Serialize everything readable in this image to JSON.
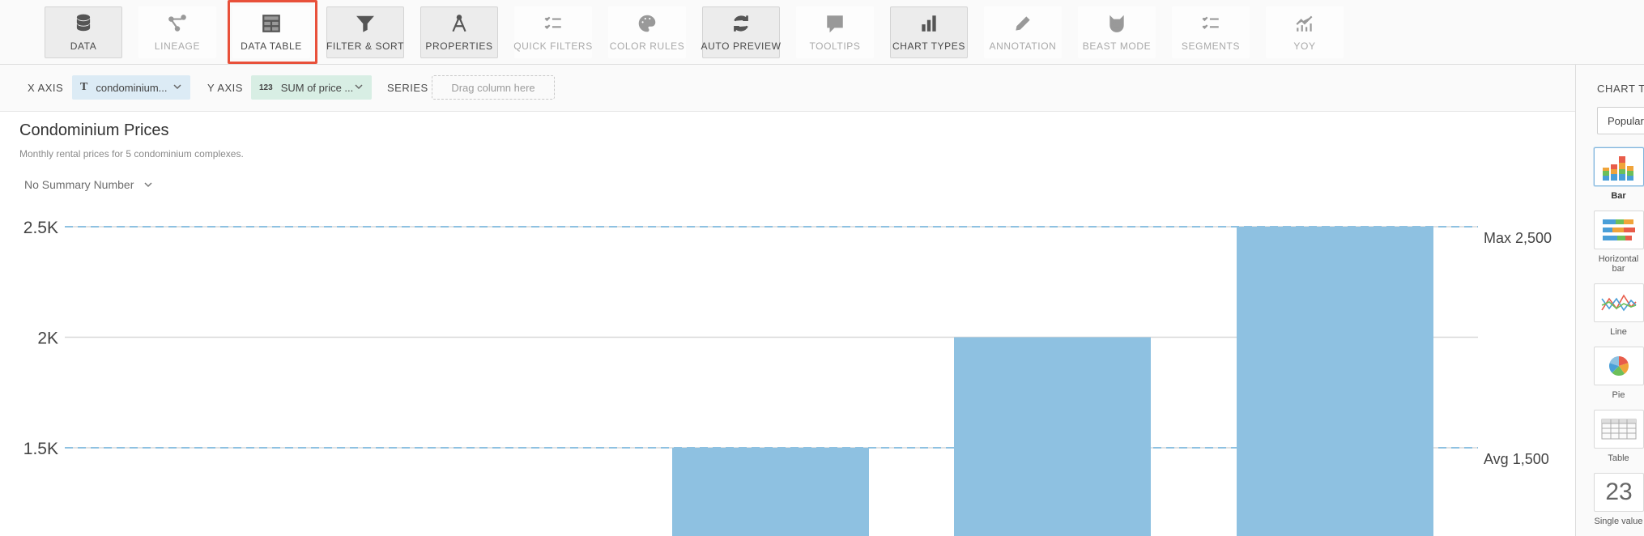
{
  "toolbar": {
    "items": [
      {
        "label": "DATA",
        "icon": "database-icon",
        "active": true
      },
      {
        "label": "LINEAGE",
        "icon": "lineage-icon",
        "active": false
      },
      {
        "label": "DATA TABLE",
        "icon": "table-icon",
        "active": false
      },
      {
        "label": "FILTER & SORT",
        "icon": "filter-icon",
        "active": true
      },
      {
        "label": "PROPERTIES",
        "icon": "compass-icon",
        "active": true
      },
      {
        "label": "QUICK FILTERS",
        "icon": "checklist-icon",
        "active": false
      },
      {
        "label": "COLOR RULES",
        "icon": "palette-icon",
        "active": false
      },
      {
        "label": "AUTO PREVIEW",
        "icon": "refresh-icon",
        "active": true
      },
      {
        "label": "TOOLTIPS",
        "icon": "speech-bubble-icon",
        "active": false
      },
      {
        "label": "CHART TYPES",
        "icon": "bar-chart-icon",
        "active": true
      },
      {
        "label": "ANNOTATION",
        "icon": "pencil-icon",
        "active": false
      },
      {
        "label": "BEAST MODE",
        "icon": "beast-mode-icon",
        "active": false
      },
      {
        "label": "SEGMENTS",
        "icon": "segments-icon",
        "active": false
      },
      {
        "label": "YOY",
        "icon": "trend-chart-icon",
        "active": false
      }
    ]
  },
  "axes": {
    "x_label": "X AXIS",
    "x_type_glyph": "T",
    "x_value": "condominium...",
    "y_label": "Y AXIS",
    "y_type_glyph": "123",
    "y_value": "SUM of price ...",
    "series_label": "SERIES",
    "series_placeholder": "Drag column here"
  },
  "chart": {
    "title": "Condominium Prices",
    "subtitle": "Monthly rental prices for 5 condominium complexes.",
    "summary_dropdown": "No Summary Number"
  },
  "chart_data": {
    "type": "bar",
    "title": "Condominium Prices",
    "subtitle": "Monthly rental prices for 5 condominium complexes.",
    "visible_y_ticks": [
      "2.5K",
      "2K",
      "1.5K"
    ],
    "visible_y_tick_values": [
      2500,
      2000,
      1500
    ],
    "ylim_visible": [
      1300,
      2500
    ],
    "values_visible": [
      1500,
      2000,
      2500
    ],
    "bar_color": "#8ec1e1",
    "reference_lines": [
      {
        "label": "Max 2,500",
        "value": 2500
      },
      {
        "label": "Avg 1,500",
        "value": 1500
      }
    ],
    "grid": true
  },
  "panel": {
    "title": "CHART TY",
    "select_value": "Popular",
    "types": [
      {
        "name": "Bar",
        "icon": "bar-chart-thumb-icon",
        "selected": true
      },
      {
        "name": "Horizontal bar",
        "icon": "horizontal-bar-thumb-icon",
        "selected": false
      },
      {
        "name": "Line",
        "icon": "line-chart-thumb-icon",
        "selected": false
      },
      {
        "name": "Pie",
        "icon": "pie-chart-thumb-icon",
        "selected": false
      },
      {
        "name": "Table",
        "icon": "table-thumb-icon",
        "selected": false
      },
      {
        "name": "Single value",
        "icon": "single-value-thumb-icon",
        "selected": false,
        "glyph": "23"
      }
    ]
  },
  "colors": {
    "accent_highlight": "#e8503a",
    "bar": "#8ec1e1",
    "x_pill": "#dcebf5",
    "y_pill": "#d8eee4",
    "reference_line": "#8ec1e1"
  }
}
